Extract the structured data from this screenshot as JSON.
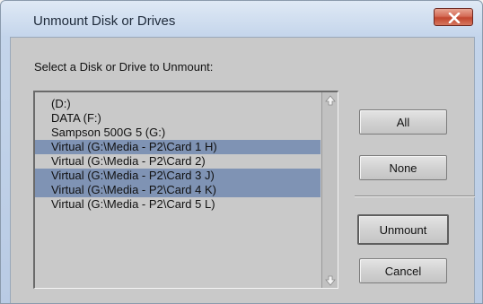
{
  "window": {
    "title": "Unmount Disk or Drives",
    "close_icon": "close-icon"
  },
  "dialog": {
    "prompt": "Select a Disk or Drive to Unmount:",
    "drives": [
      {
        "label": "(D:)",
        "selected": false
      },
      {
        "label": "DATA (F:)",
        "selected": false
      },
      {
        "label": "Sampson 500G 5 (G:)",
        "selected": false
      },
      {
        "label": "Virtual (G:\\Media - P2\\Card 1 H)",
        "selected": true
      },
      {
        "label": "Virtual (G:\\Media - P2\\Card 2)",
        "selected": false
      },
      {
        "label": "Virtual (G:\\Media - P2\\Card 3 J)",
        "selected": true
      },
      {
        "label": "Virtual (G:\\Media - P2\\Card 4 K)",
        "selected": true
      },
      {
        "label": "Virtual (G:\\Media - P2\\Card 5 L)",
        "selected": false
      }
    ],
    "scroll_icons": {
      "up": "scroll-up-arrow-icon",
      "down": "scroll-down-arrow-icon"
    }
  },
  "buttons": {
    "all": "All",
    "none": "None",
    "unmount": "Unmount",
    "cancel": "Cancel"
  },
  "colors": {
    "selection": "#7f93b4",
    "close_button": "#c2462f",
    "panel_background": "#c9c9c9"
  }
}
